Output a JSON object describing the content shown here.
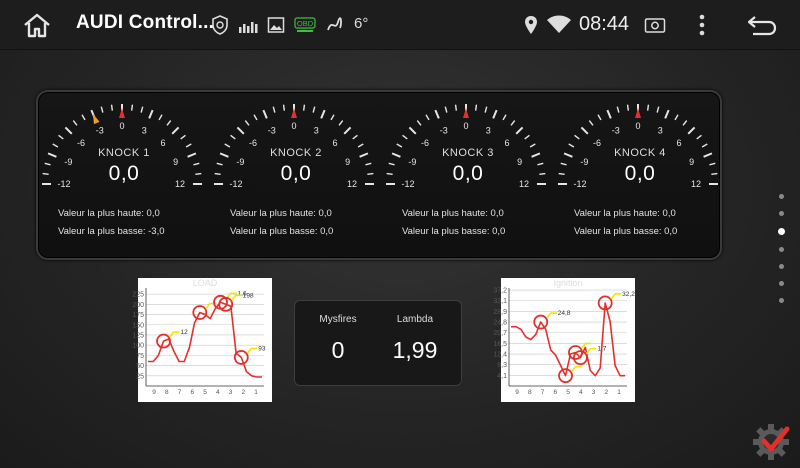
{
  "statusbar": {
    "title": "AUDI Control...",
    "temperature": "6°",
    "time": "08:44",
    "obd_label": "OBD"
  },
  "gauges": [
    {
      "name": "KNOCK 1",
      "value": "0,0",
      "high_label": "Valeur la plus haute: 0,0",
      "low_label": "Valeur la plus basse: -3,0",
      "peak": -3
    },
    {
      "name": "KNOCK 2",
      "value": "0,0",
      "high_label": "Valeur la plus haute: 0,0",
      "low_label": "Valeur la plus basse: 0,0",
      "peak": 0
    },
    {
      "name": "KNOCK 3",
      "value": "0,0",
      "high_label": "Valeur la plus haute: 0,0",
      "low_label": "Valeur la plus basse: 0,0",
      "peak": 0
    },
    {
      "name": "KNOCK 4",
      "value": "0,0",
      "high_label": "Valeur la plus haute: 0,0",
      "low_label": "Valeur la plus basse: 0,0",
      "peak": 0
    }
  ],
  "gauge_scale": {
    "labels": [
      "-12",
      "-9",
      "-6",
      "-3",
      "0",
      "3",
      "6",
      "9",
      "12"
    ]
  },
  "middle": {
    "misfires_label": "Mysfires",
    "misfires_value": "0",
    "lambda_label": "Lambda",
    "lambda_value": "1,99"
  },
  "chart_data": [
    {
      "type": "line",
      "title": "LOAD",
      "yticks": [
        "25",
        "50",
        "75",
        "100",
        "125",
        "150",
        "175",
        "200",
        "225"
      ],
      "ylim": [
        0,
        240
      ],
      "xticks": [
        "9",
        "8",
        "7",
        "6",
        "5",
        "4",
        "3",
        "2",
        "1"
      ],
      "values": [
        60,
        60,
        75,
        110,
        115,
        85,
        60,
        60,
        95,
        155,
        180,
        175,
        165,
        190,
        205,
        200,
        195,
        80,
        70,
        35,
        25,
        22,
        22
      ],
      "markers": [
        {
          "label": "12",
          "index": 3
        },
        {
          "label": "",
          "index": 10
        },
        {
          "label": "1,6",
          "index": 14
        },
        {
          "label": "198",
          "index": 15
        },
        {
          "label": "93",
          "index": 18
        }
      ]
    },
    {
      "type": "line",
      "title": "Ignition",
      "yticks": [
        "4,1",
        "8,3",
        "12,4",
        "16,5",
        "20,7",
        "24,8",
        "28,9",
        "33,1",
        "37,2"
      ],
      "ylim": [
        0,
        38
      ],
      "xticks": [
        "9",
        "8",
        "7",
        "6",
        "5",
        "4",
        "3",
        "2",
        "1"
      ],
      "values": [
        23,
        23,
        22,
        19,
        18,
        20,
        24.8,
        22,
        14,
        12,
        8,
        4,
        12.4,
        13,
        11,
        15,
        6,
        4,
        7,
        32.2,
        25,
        8,
        4,
        4
      ],
      "markers": [
        {
          "label": "24,8",
          "index": 6
        },
        {
          "label": "",
          "index": 11
        },
        {
          "label": "",
          "index": 13
        },
        {
          "label": "1,7",
          "index": 14
        },
        {
          "label": "32,2",
          "index": 19
        }
      ]
    }
  ],
  "colors": {
    "accent_red": "#e0312d",
    "marker_yellow": "#f0e800",
    "needle_orange": "#f0a020"
  },
  "page_dots": {
    "count": 7,
    "active": 2
  }
}
